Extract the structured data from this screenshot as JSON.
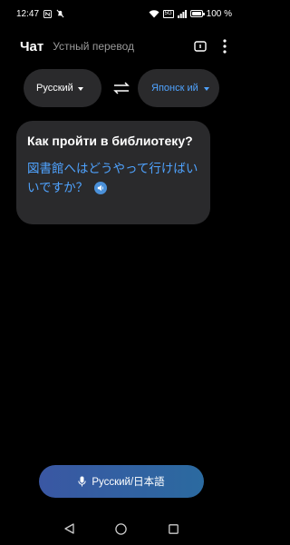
{
  "status_bar": {
    "time": "12:47",
    "battery": "100 %",
    "battery_level": 1.0,
    "net_label": "5G",
    "icons": [
      "nfc-icon",
      "mute-icon",
      "wifi-icon",
      "signal-icon",
      "battery-icon"
    ]
  },
  "header": {
    "title": "Чат",
    "subtitle": "Устный перевод",
    "actions": [
      "book-icon",
      "more-vert-icon"
    ]
  },
  "languages": {
    "source": "Русский",
    "target": "Японск ий",
    "swap_icon": "swap-arrows-icon"
  },
  "card": {
    "source_text": "Как пройти в библиотеку?",
    "target_text": "図書館へはどうやって行けばいいですか？",
    "speak_icon": "speaker-icon"
  },
  "mic_button": {
    "label": "Русский/日本語",
    "icon": "mic-icon"
  },
  "nav": {
    "items": [
      "back-icon",
      "home-icon",
      "recents-icon"
    ]
  },
  "colors": {
    "background": "#000000",
    "surface": "#2a2a2c",
    "accent": "#4fa3ff",
    "muted_text": "#9a9a9a"
  }
}
